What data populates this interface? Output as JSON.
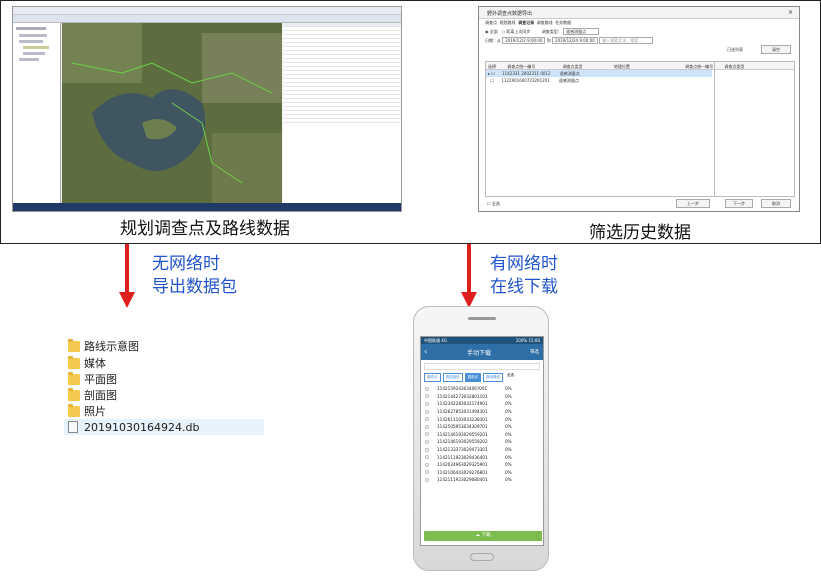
{
  "captions": {
    "left": "规划调查点及路线数据",
    "right": "筛选历史数据",
    "arrow_left_line1": "无网络时",
    "arrow_left_line2": "导出数据包",
    "arrow_right_line1": "有网络时",
    "arrow_right_line2": "在线下载"
  },
  "dialog": {
    "title": "野外调查点数据导出",
    "tabs": [
      "调查点",
      "规划路线",
      "调查记录",
      "调查路线",
      "任务数据"
    ],
    "radio_all": "全部",
    "radio_since": "距离上次同步",
    "type_label": "调查类型",
    "type_value": "遥感测量点",
    "date_label": "日期：从",
    "date_from": "2019/12/2 9:00:00",
    "date_to_label": "到",
    "date_to": "2019/12/24 9:00:00",
    "search_placeholder": "输入搜索文本，搜索…",
    "selected_list": "已选列表",
    "clear": "清空",
    "col_select": "选择",
    "col_code": "调查点统一编号",
    "col_type": "调查点类型",
    "col_place": "地理位置",
    "col_code2": "调查点统一编号",
    "col_type2": "调查点类型",
    "rows": [
      {
        "code": "1142331 2002311 0012",
        "type": "遥感测量点"
      },
      {
        "code": "1122901600723291201",
        "type": "遥感测量点"
      }
    ],
    "select_all": "全选",
    "prev": "上一步",
    "next": "下一步",
    "cancel": "取消"
  },
  "files": {
    "folders": [
      "路线示意图",
      "媒体",
      "平面图",
      "剖面图",
      "照片"
    ],
    "db": "20191030164924.db"
  },
  "phone": {
    "status": "中国联通 4G",
    "status_right": "100% 15:00",
    "title": "手动下载",
    "filter": "筛选",
    "tabs": [
      "调查点",
      "调查路线",
      "调查点",
      "路线路线"
    ],
    "select_all": "全选",
    "items": [
      {
        "code": "114215924303406?001",
        "pct": "0%"
      },
      {
        "code": "1142144273032801101",
        "pct": "0%"
      },
      {
        "code": "1142342283032174901",
        "pct": "0%"
      },
      {
        "code": "1142627853031494301",
        "pct": "0%"
      },
      {
        "code": "1142611103033238301",
        "pct": "0%"
      },
      {
        "code": "1142505953034309701",
        "pct": "0%"
      },
      {
        "code": "1142146193029559201",
        "pct": "0%"
      },
      {
        "code": "1142146193029559202",
        "pct": "0%"
      },
      {
        "code": "1142133373029473301",
        "pct": "0%"
      },
      {
        "code": "1142111923029436401",
        "pct": "0%"
      },
      {
        "code": "1142024963029325901",
        "pct": "0%"
      },
      {
        "code": "1142106443029276801",
        "pct": "0%"
      },
      {
        "code": "1142111923029080401",
        "pct": "0%"
      }
    ],
    "download": "下载"
  },
  "colors": {
    "arrow": "#e01f1f",
    "caption_blue": "#2255cc",
    "phone_green": "#7cbd4f",
    "phone_blue": "#2d6fa6"
  }
}
